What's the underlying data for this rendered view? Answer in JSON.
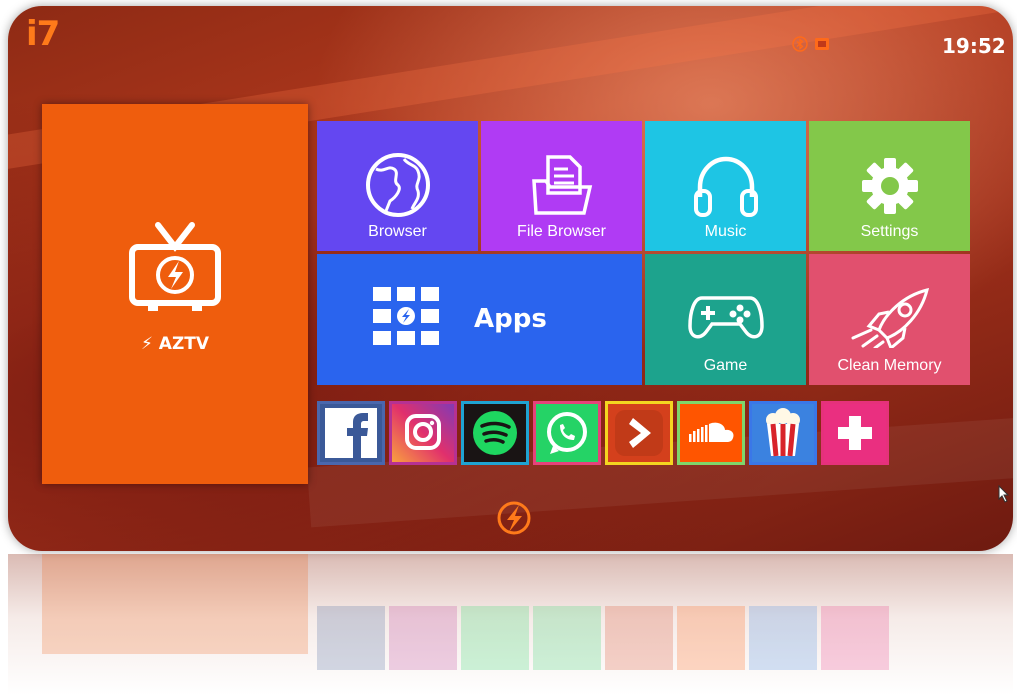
{
  "brand": "i7",
  "status": {
    "time": "19:52",
    "icons": [
      "bluetooth-icon",
      "ethernet-icon"
    ]
  },
  "main_tile": {
    "label": "AZTV",
    "icon": "tv-icon",
    "color": "#ef5d0d"
  },
  "tiles": [
    {
      "label": "Browser",
      "icon": "globe-icon",
      "color": "#6447f1"
    },
    {
      "label": "File Browser",
      "icon": "folder-icon",
      "color": "#b03bf4"
    },
    {
      "label": "Music",
      "icon": "headphones-icon",
      "color": "#1ec5e4"
    },
    {
      "label": "Settings",
      "icon": "gear-icon",
      "color": "#83c84a"
    },
    {
      "label": "Apps",
      "icon": "apps-grid-icon",
      "color": "#2a64ee"
    },
    {
      "label": "Game",
      "icon": "gamepad-icon",
      "color": "#1da38d"
    },
    {
      "label": "Clean Memory",
      "icon": "rocket-icon",
      "color": "#e1506e"
    }
  ],
  "apps": [
    {
      "name": "Facebook",
      "icon": "facebook-icon",
      "border": "#4a67ad"
    },
    {
      "name": "Instagram",
      "icon": "instagram-icon",
      "border": "#b63193"
    },
    {
      "name": "Spotify",
      "icon": "spotify-icon",
      "border": "#1fa3d2"
    },
    {
      "name": "WhatsApp",
      "icon": "whatsapp-icon",
      "border": "#e6427a"
    },
    {
      "name": "Video app",
      "icon": "play-arrow-icon",
      "border": "#f4d520"
    },
    {
      "name": "SoundCloud",
      "icon": "soundcloud-icon",
      "border": "#7fd66a"
    },
    {
      "name": "Popcorn Time",
      "icon": "popcorn-icon",
      "border": "#3a77e8"
    },
    {
      "name": "Add app",
      "icon": "plus-icon",
      "border": "#e6317b"
    }
  ]
}
